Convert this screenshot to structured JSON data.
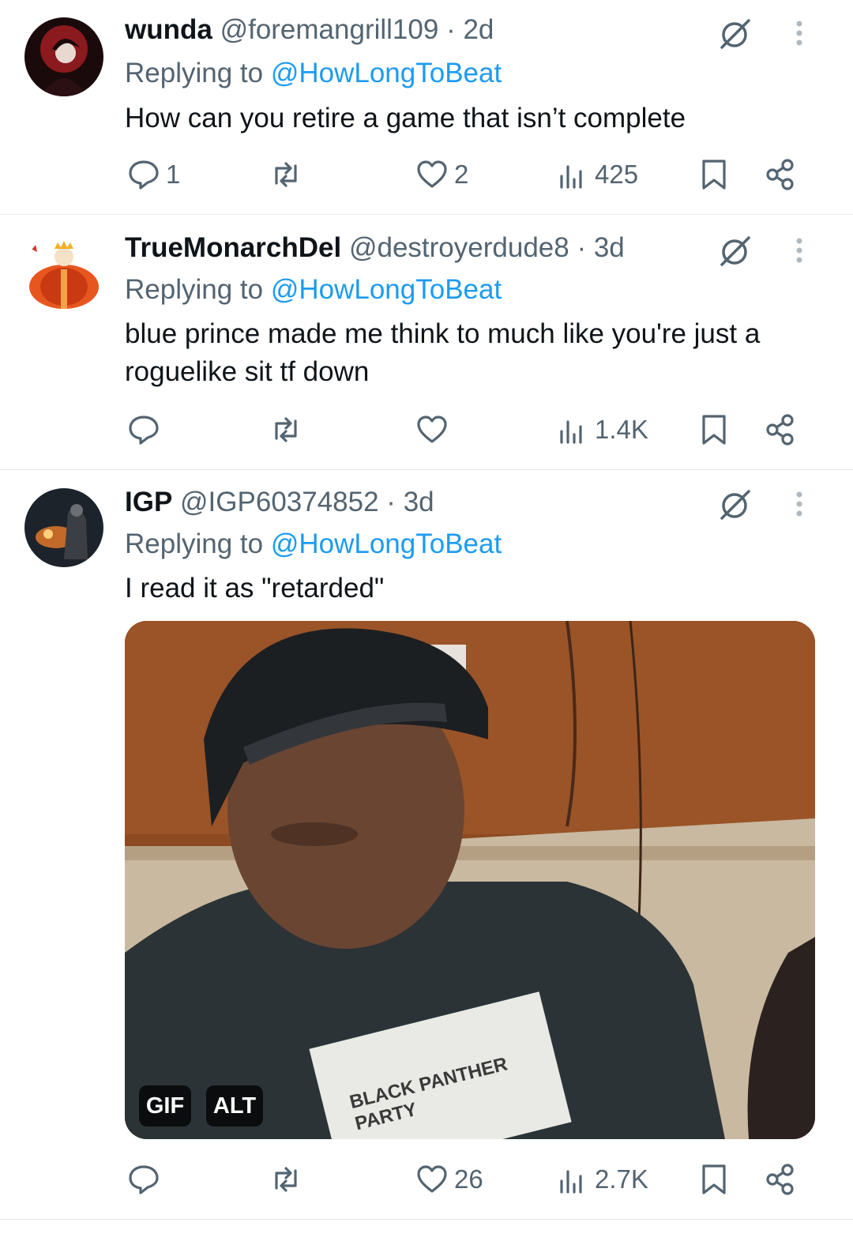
{
  "tweets": [
    {
      "name": "wunda",
      "handle": "@foremangrill109",
      "sep": " · ",
      "age": "2d",
      "reply_prefix": "Replying to ",
      "reply_to": "@HowLongToBeat",
      "text": "How can you retire a game that isn’t complete",
      "replies": "1",
      "retweets": "",
      "likes": "2",
      "views": "425"
    },
    {
      "name": "TrueMonarchDel",
      "handle": "@destroyerdude8",
      "sep": " · ",
      "age": "3d",
      "reply_prefix": "Replying to ",
      "reply_to": "@HowLongToBeat",
      "text": "blue prince made me think to much like you're just a roguelike sit tf down",
      "replies": "",
      "retweets": "",
      "likes": "",
      "views": "1.4K"
    },
    {
      "name": "IGP",
      "handle": "@IGP60374852",
      "sep": " · ",
      "age": "3d",
      "reply_prefix": "Replying to ",
      "reply_to": "@HowLongToBeat",
      "text": "I read it as \"retarded\"",
      "media": {
        "gif_badge": "GIF",
        "alt_badge": "ALT",
        "shirt_text": "BLACK PANTHER PARTY"
      },
      "replies": "",
      "retweets": "",
      "likes": "26",
      "views": "2.7K"
    }
  ],
  "colors": {
    "link": "#1d9bf0",
    "muted": "#536471",
    "text": "#0f1419",
    "divider": "#e6e8ea"
  },
  "icons": [
    "reply-icon",
    "retweet-icon",
    "like-icon",
    "views-icon",
    "bookmark-icon",
    "share-icon",
    "grok-icon",
    "more-icon"
  ]
}
